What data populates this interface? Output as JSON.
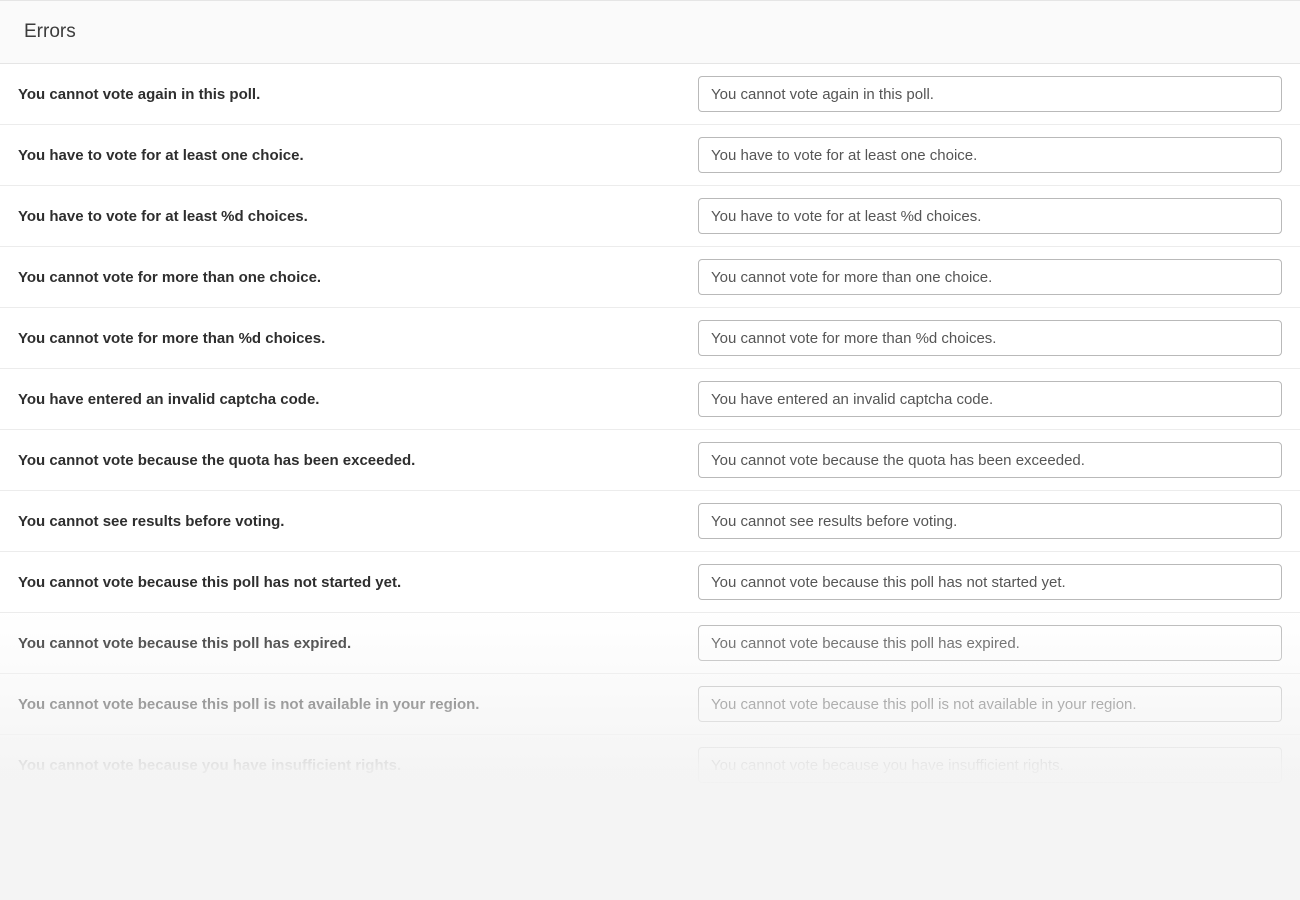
{
  "header": {
    "title": "Errors"
  },
  "rows": [
    {
      "label": "You cannot vote again in this poll.",
      "value": "You cannot vote again in this poll."
    },
    {
      "label": "You have to vote for at least one choice.",
      "value": "You have to vote for at least one choice."
    },
    {
      "label": "You have to vote for at least %d choices.",
      "value": "You have to vote for at least %d choices."
    },
    {
      "label": "You cannot vote for more than one choice.",
      "value": "You cannot vote for more than one choice."
    },
    {
      "label": "You cannot vote for more than %d choices.",
      "value": "You cannot vote for more than %d choices."
    },
    {
      "label": "You have entered an invalid captcha code.",
      "value": "You have entered an invalid captcha code."
    },
    {
      "label": "You cannot vote because the quota has been exceeded.",
      "value": "You cannot vote because the quota has been exceeded."
    },
    {
      "label": "You cannot see results before voting.",
      "value": "You cannot see results before voting."
    },
    {
      "label": "You cannot vote because this poll has not started yet.",
      "value": "You cannot vote because this poll has not started yet."
    },
    {
      "label": "You cannot vote because this poll has expired.",
      "value": "You cannot vote because this poll has expired."
    },
    {
      "label": "You cannot vote because this poll is not available in your region.",
      "value": "You cannot vote because this poll is not available in your region."
    },
    {
      "label": "You cannot vote because you have insufficient rights.",
      "value": "You cannot vote because you have insufficient rights."
    }
  ]
}
